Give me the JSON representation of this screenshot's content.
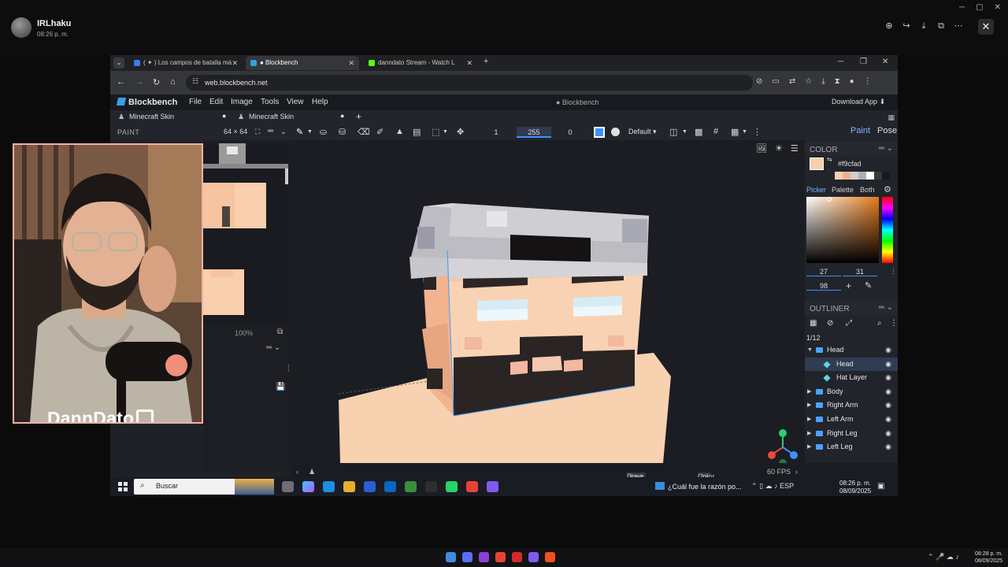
{
  "outer": {
    "username": "IRLhaku",
    "time": "08:26 p. m.",
    "tool_icons": [
      "zoom-in-icon",
      "share-icon",
      "download-icon",
      "open-external-icon",
      "more-icon"
    ]
  },
  "browser": {
    "tabs": [
      {
        "label": "( ✦ ) Los campos de batalla má",
        "color": "#3c7bf0"
      },
      {
        "label": "● Blockbench",
        "color": "#2fa0e0",
        "active": true
      },
      {
        "label": "danndato Stream - Watch L",
        "color": "#53fc18"
      }
    ],
    "url": "web.blockbench.net"
  },
  "blockbench": {
    "logo": "Blockbench",
    "menus": [
      "File",
      "Edit",
      "Image",
      "Tools",
      "View",
      "Help"
    ],
    "center_title": "● Blockbench",
    "download_app": "Download App",
    "project_tabs": [
      "Minecraft Skin",
      "Minecraft Skin"
    ],
    "paint_label": "PAINT",
    "resolution": "64 × 64",
    "toolbar": {
      "value_1": "1",
      "value_2": "255",
      "value_3": "0",
      "blend_mode": "Default"
    },
    "modes": {
      "paint": "Paint",
      "pose": "Pose"
    },
    "uv_zoom": "100%",
    "color": {
      "section": "COLOR",
      "hex": "#f9cfad",
      "main_color": "#f9cfad",
      "palette": [
        "#f9cfad",
        "#e7b596",
        "#cfcfcf",
        "#b0b0b0",
        "#ffffff",
        "#3a3a3a",
        "#1a1a1a"
      ],
      "tabs": [
        "Picker",
        "Palette",
        "Both"
      ],
      "h": "27",
      "s": "31",
      "v": "98"
    },
    "outliner": {
      "section": "OUTLINER",
      "count": "1/12",
      "items": [
        {
          "label": "Head",
          "kind": "folder",
          "level": 0,
          "expanded": true
        },
        {
          "label": "Head",
          "kind": "cube",
          "level": 1,
          "selected": true
        },
        {
          "label": "Hat Layer",
          "kind": "cube",
          "level": 1
        },
        {
          "label": "Body",
          "kind": "folder",
          "level": 0
        },
        {
          "label": "Right Arm",
          "kind": "folder",
          "level": 0
        },
        {
          "label": "Left Arm",
          "kind": "folder",
          "level": 0
        },
        {
          "label": "Right Leg",
          "kind": "folder",
          "level": 0
        },
        {
          "label": "Left Leg",
          "kind": "folder",
          "level": 0
        }
      ]
    },
    "status": {
      "shift_key": "Shift",
      "shift_action": "Draw line",
      "alt_key": "Alt",
      "alt_action": "Color Picker",
      "fps": "60 FPS"
    }
  },
  "inner_taskbar": {
    "search_placeholder": "Buscar",
    "news": "¿Cuál fue la razón po...",
    "lang": "ESP",
    "time": "08:26 p. m.",
    "date": "08/09/2025"
  },
  "cam": {
    "streamer_name": "DannDato"
  },
  "outer_taskbar": {
    "time": "08:28 p. m.",
    "date": "08/09/2025"
  }
}
